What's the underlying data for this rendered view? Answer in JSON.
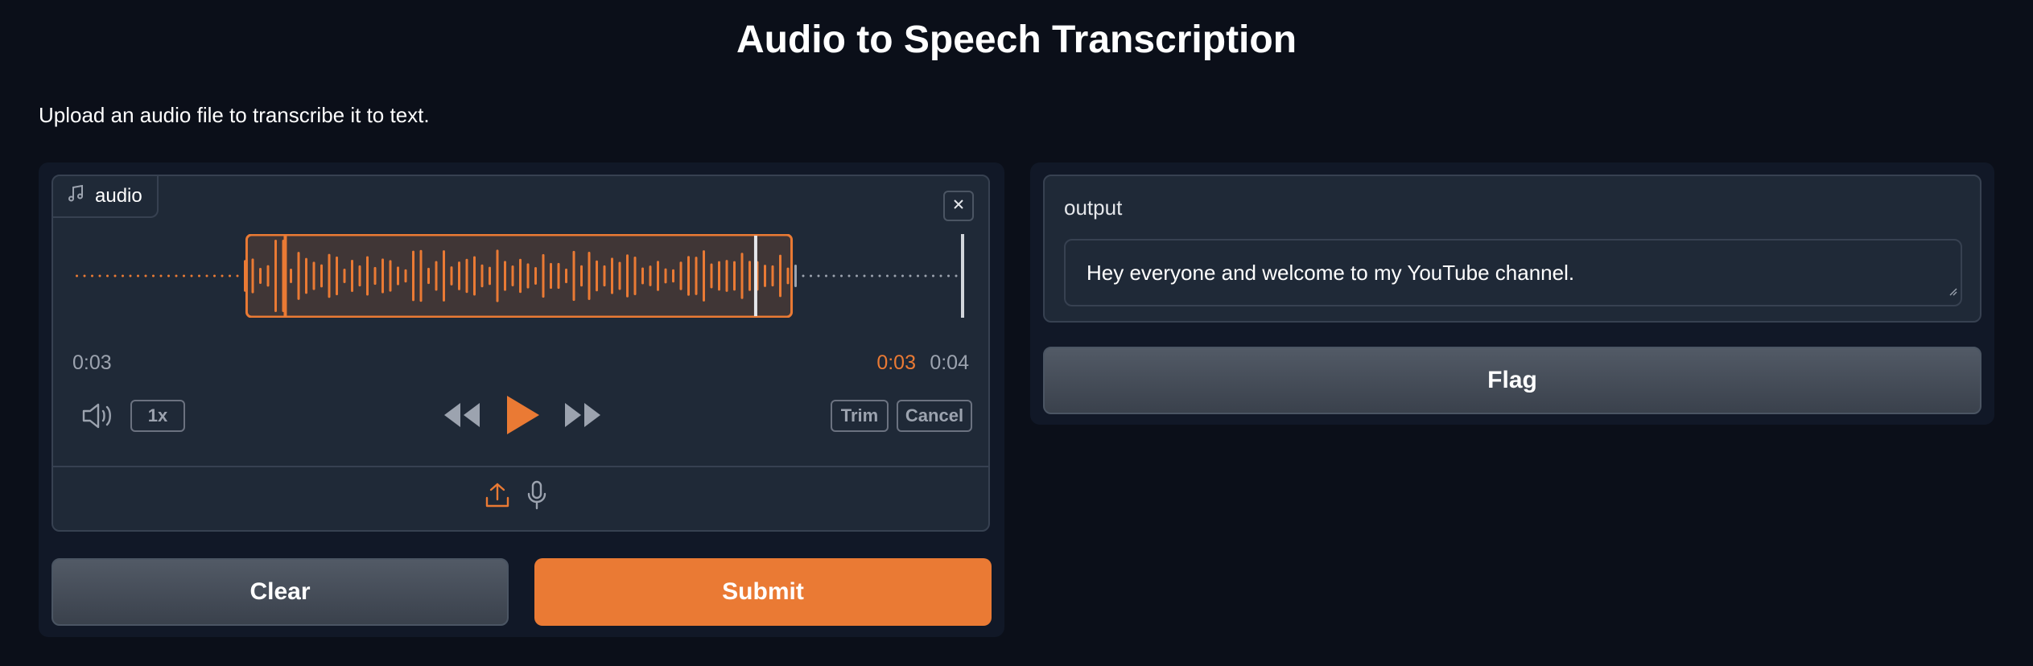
{
  "page": {
    "title": "Audio to Speech Transcription",
    "description": "Upload an audio file to transcribe it to text."
  },
  "audio": {
    "label": "audio",
    "icon": "music-note-icon",
    "time_start": "0:03",
    "time_current": "0:03",
    "time_end": "0:04",
    "speed": "1x",
    "trim_label": "Trim",
    "cancel_label": "Cancel",
    "selection": {
      "start_fraction": 0.195,
      "end_fraction": 0.805,
      "playhead_fraction": 0.763
    }
  },
  "actions": {
    "clear_label": "Clear",
    "submit_label": "Submit"
  },
  "output": {
    "label": "output",
    "value": "Hey everyone and welcome to my YouTube channel."
  },
  "flag": {
    "label": "Flag"
  },
  "colors": {
    "accent": "#ea7a34",
    "background": "#0b0f19",
    "panel": "#111827",
    "block": "#1f2937"
  }
}
